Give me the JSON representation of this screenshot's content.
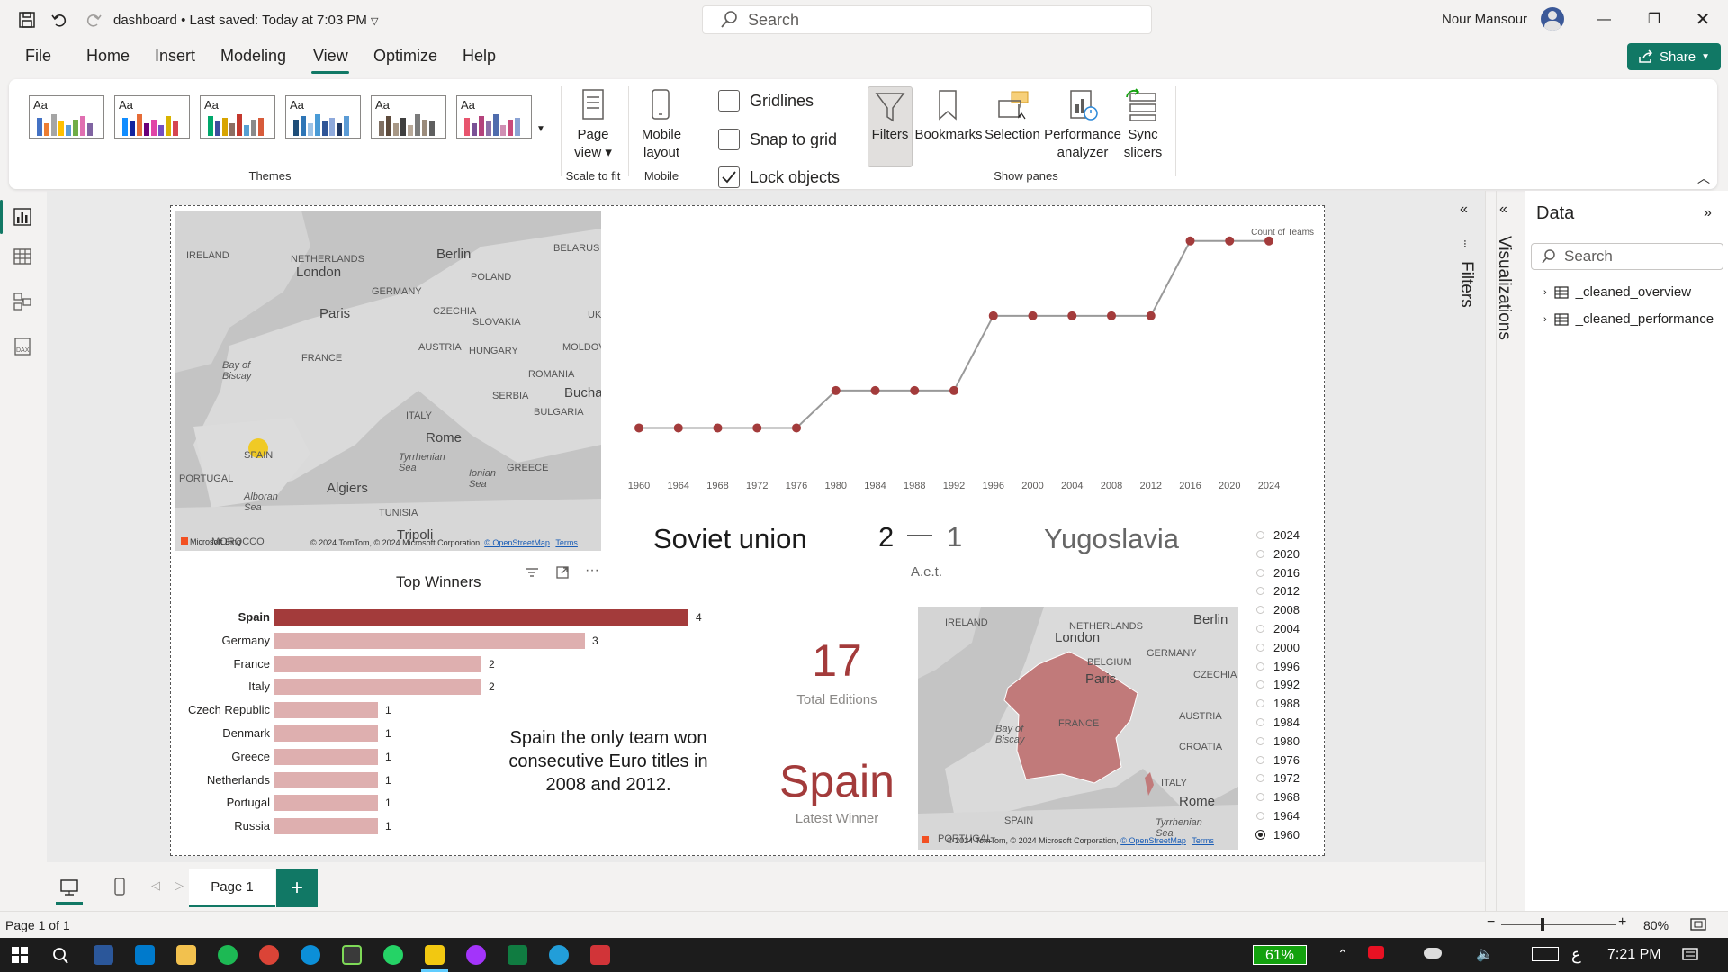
{
  "titlebar": {
    "doc_name": "dashboard",
    "saved": "Last saved: Today at 7:03 PM",
    "search_placeholder": "Search",
    "user_name": "Nour Mansour"
  },
  "menu": {
    "items": [
      "File",
      "Home",
      "Insert",
      "Modeling",
      "View",
      "Optimize",
      "Help"
    ],
    "active": "View",
    "share_label": "Share"
  },
  "ribbon": {
    "themes_label": "Themes",
    "theme_aa": "Aa",
    "page_view": "Page view",
    "scale_to_fit": "Scale to fit",
    "mobile_layout": "Mobile layout",
    "mobile": "Mobile",
    "gridlines": "Gridlines",
    "snap_to_grid": "Snap to grid",
    "lock_objects": "Lock objects",
    "filters": "Filters",
    "bookmarks": "Bookmarks",
    "selection": "Selection",
    "performance_analyzer": "Performance analyzer",
    "sync_slicers": "Sync slicers",
    "show_panes": "Show panes",
    "checks": {
      "gridlines": false,
      "snap_to_grid": false,
      "lock_objects": true
    }
  },
  "map_top": {
    "labels": [
      "IRELAND",
      "NETHERLANDS",
      "London",
      "Berlin",
      "BELARUS",
      "GERMANY",
      "POLAND",
      "Paris",
      "CZECHIA",
      "SLOVAKIA",
      "UKR",
      "AUSTRIA",
      "HUNGARY",
      "MOLDOVA",
      "FRANCE",
      "ROMANIA",
      "Bay of Biscay",
      "SERBIA",
      "Bucha",
      "ITALY",
      "BULGARIA",
      "SPAIN",
      "Rome",
      "PORTUGAL",
      "Tyrrhenian Sea",
      "Ionian Sea",
      "GREECE",
      "Algiers",
      "Alboran Sea",
      "TUNISIA",
      "MOROCCO",
      "Tripoli"
    ],
    "copyright": "© 2024 TomTom, © 2024 Microsoft Corporation,",
    "osm": "© OpenStreetMap",
    "terms": "Terms",
    "brand": "Microsoft Bing"
  },
  "chart_data": [
    {
      "type": "line",
      "title": "",
      "legend": "Count of Teams",
      "x": [
        "1960",
        "1964",
        "1968",
        "1972",
        "1976",
        "1980",
        "1984",
        "1988",
        "1992",
        "1996",
        "2000",
        "2004",
        "2008",
        "2012",
        "2016",
        "2020",
        "2024"
      ],
      "values": [
        4,
        4,
        4,
        4,
        4,
        8,
        8,
        8,
        8,
        16,
        16,
        16,
        16,
        16,
        24,
        24,
        24
      ],
      "ylim": [
        0,
        26
      ],
      "grid": false,
      "color": "#a33b3b"
    },
    {
      "type": "bar",
      "title": "Top Winners",
      "categories": [
        "Spain",
        "Germany",
        "France",
        "Italy",
        "Czech Republic",
        "Denmark",
        "Greece",
        "Netherlands",
        "Portugal",
        "Russia"
      ],
      "values": [
        4,
        3,
        2,
        2,
        1,
        1,
        1,
        1,
        1,
        1
      ],
      "xlim": [
        0,
        4
      ],
      "highlight": "Spain",
      "highlight_color": "#a33b3b",
      "color": "#deafaf"
    }
  ],
  "final_card": {
    "team_a": "Soviet union",
    "score_a": "2",
    "dash": "—",
    "score_b": "1",
    "team_b": "Yugoslavia",
    "note": "A.e.t."
  },
  "insight_text": "Spain the only team won consecutive Euro titles in 2008 and 2012.",
  "kpi_editions": {
    "value": "17",
    "label": "Total Editions"
  },
  "kpi_winner": {
    "value": "Spain",
    "label": "Latest Winner"
  },
  "slicer": {
    "years": [
      "2024",
      "2020",
      "2016",
      "2012",
      "2008",
      "2004",
      "2000",
      "1996",
      "1992",
      "1988",
      "1984",
      "1980",
      "1976",
      "1972",
      "1968",
      "1964",
      "1960"
    ],
    "selected": "1960"
  },
  "map_bottom": {
    "labels": [
      "IRELAND",
      "NETHERLANDS",
      "London",
      "Berlin",
      "BELGIUM",
      "GERMANY",
      "CZECHIA",
      "Paris",
      "FRANCE",
      "AUSTRIA",
      "Bay of Biscay",
      "CROATIA",
      "ITALY",
      "Rome",
      "SPAIN",
      "PORTUGAL",
      "Tyrrhenian Sea"
    ],
    "copyright": "© 2024 TomTom, © 2024 Microsoft Corporation,",
    "osm": "© OpenStreetMap",
    "terms": "Terms"
  },
  "panes": {
    "filters": "Filters",
    "visualizations": "Visualizations",
    "data_title": "Data",
    "search_placeholder": "Search",
    "tables": [
      "_cleaned_overview",
      "_cleaned_performance"
    ]
  },
  "pages": {
    "tab": "Page 1",
    "status": "Page 1 of 1",
    "zoom": "80%"
  },
  "taskbar": {
    "battery": "61%",
    "lang": "ع",
    "time": "7:21 PM"
  },
  "colors": {
    "accent": "#117865",
    "brand_red": "#a33b3b",
    "bar_light": "#deafaf"
  }
}
